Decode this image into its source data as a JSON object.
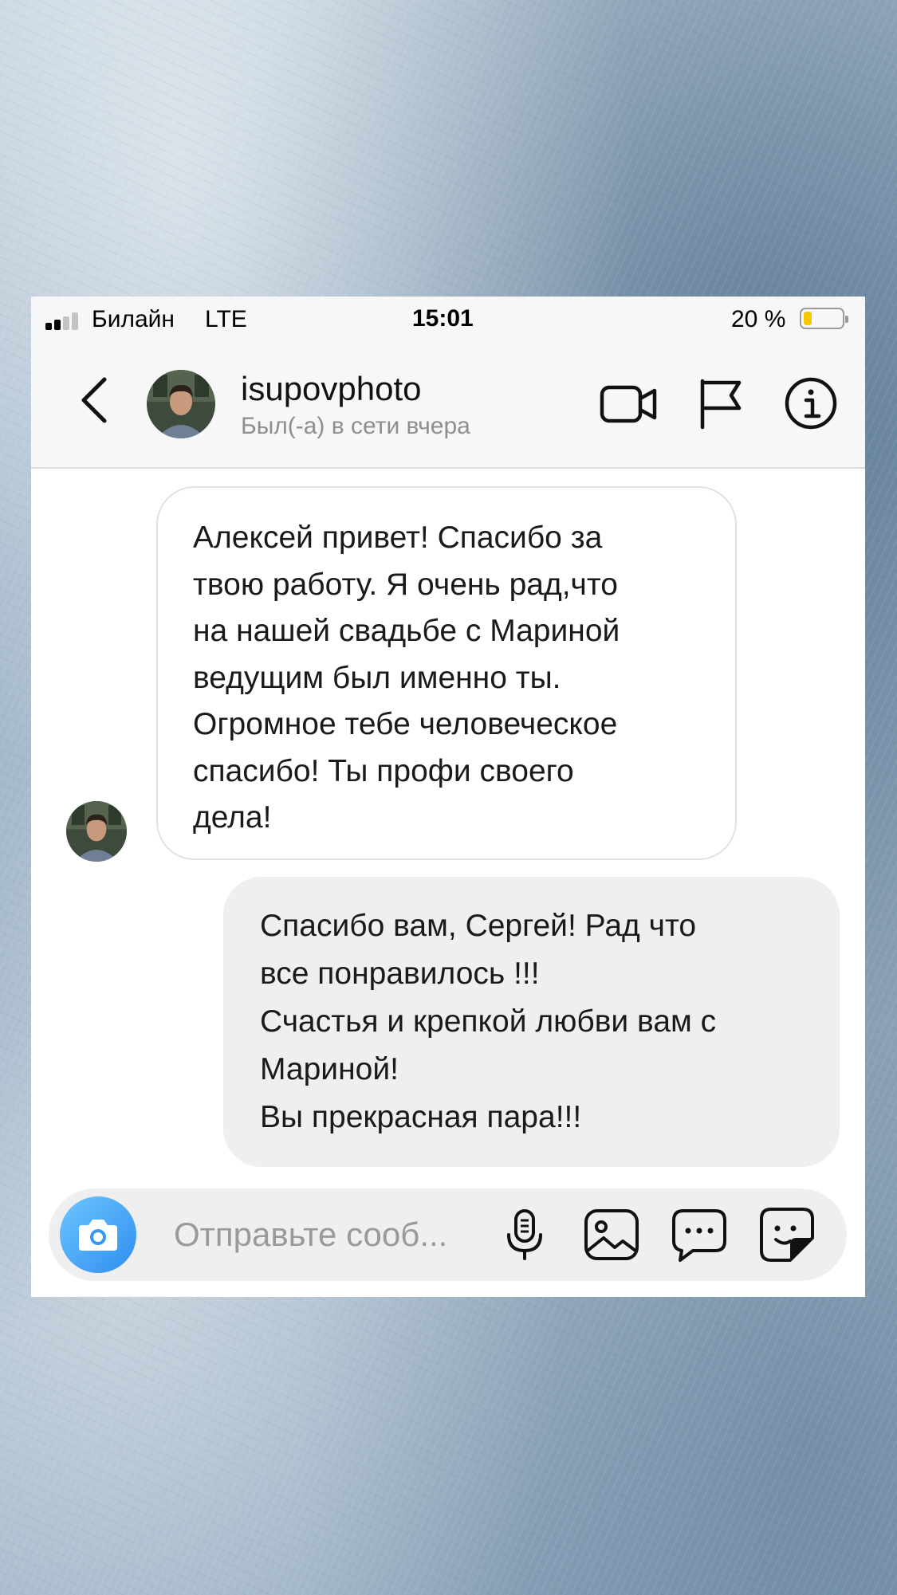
{
  "status_bar": {
    "carrier": "Билайн",
    "network": "LTE",
    "time": "15:01",
    "battery_text": "20 %",
    "battery_level": 0.2
  },
  "header": {
    "username": "isupovphoto",
    "status": "Был(-а) в сети вчера",
    "icons": [
      "back-chevron-icon",
      "video-call-icon",
      "flag-icon",
      "info-icon"
    ]
  },
  "messages": [
    {
      "direction": "incoming",
      "lines": [
        "Алексей привет! Спасибо за",
        "твою работу. Я очень рад,что",
        "на нашей свадьбе с Мариной",
        "ведущим был именно ты.",
        "Огромное тебе человеческое",
        "спасибо! Ты профи своего",
        "дела!"
      ]
    },
    {
      "direction": "outgoing",
      "lines": [
        "Спасибо вам, Сергей! Рад что",
        "все понравилось !!!",
        "Счастья и крепкой любви вам с",
        "Мариной!",
        "Вы прекрасная пара!!!"
      ]
    }
  ],
  "composer": {
    "placeholder": "Отправьте сооб...",
    "icons": [
      "camera-icon",
      "microphone-icon",
      "gallery-icon",
      "quick-reply-icon",
      "sticker-icon"
    ]
  },
  "colors": {
    "camera_button": "#3897f0",
    "battery_fill": "#f5c800",
    "outgoing_bubble": "#efefef"
  }
}
